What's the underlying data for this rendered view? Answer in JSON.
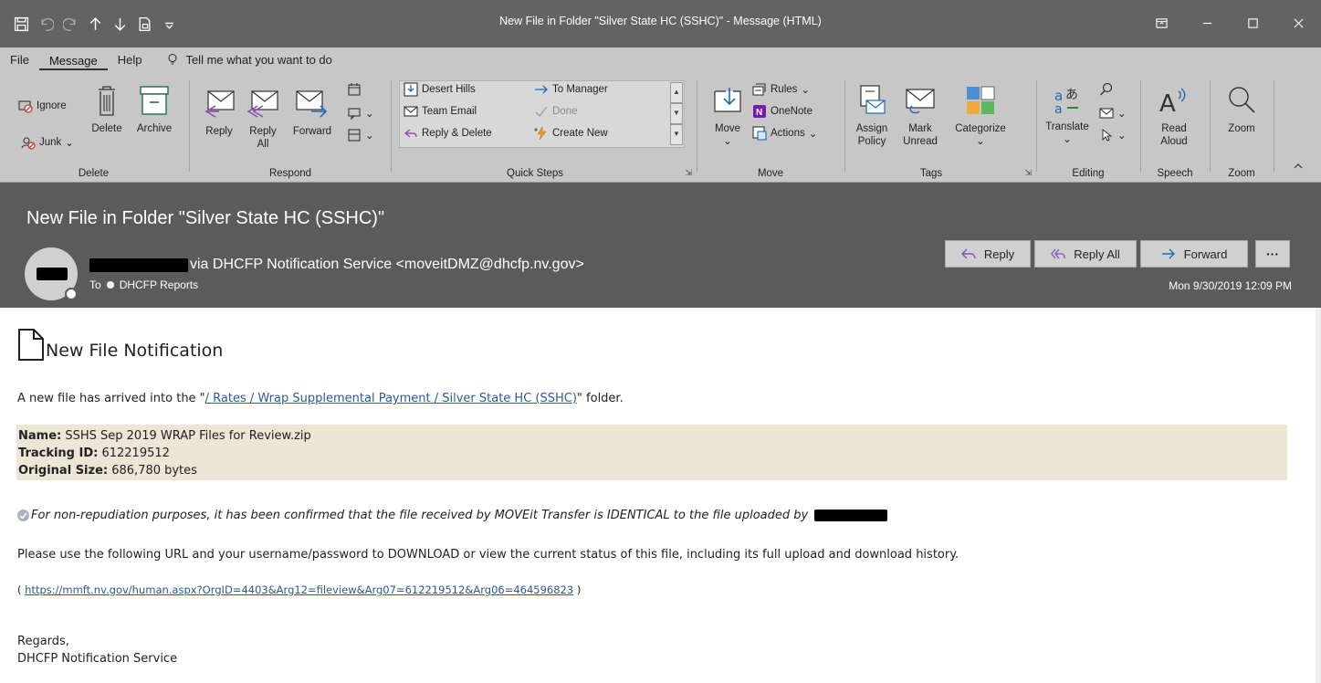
{
  "window": {
    "title": "New File in Folder \"Silver State HC (SSHC)\"  -  Message (HTML)"
  },
  "ribbon_tabs": {
    "file": "File",
    "message": "Message",
    "help": "Help",
    "tell_me": "Tell me what you want to do"
  },
  "ribbon": {
    "delete_group": {
      "label": "Delete",
      "ignore": "Ignore",
      "junk": "Junk",
      "delete": "Delete",
      "archive": "Archive"
    },
    "respond_group": {
      "label": "Respond",
      "reply": "Reply",
      "reply_all_1": "Reply",
      "reply_all_2": "All",
      "forward": "Forward"
    },
    "quick_steps_group": {
      "label": "Quick Steps",
      "desert_hills": "Desert Hills",
      "team_email": "Team Email",
      "reply_delete": "Reply & Delete",
      "to_manager": "To Manager",
      "done": "Done",
      "create_new": "Create New"
    },
    "move_group": {
      "label": "Move",
      "move": "Move",
      "rules": "Rules",
      "onenote": "OneNote",
      "actions": "Actions"
    },
    "tags_group": {
      "label": "Tags",
      "assign_1": "Assign",
      "assign_2": "Policy",
      "mark_1": "Mark",
      "mark_2": "Unread",
      "categorize": "Categorize"
    },
    "editing_group": {
      "label": "Editing",
      "translate": "Translate"
    },
    "speech_group": {
      "label": "Speech",
      "read_1": "Read",
      "read_2": "Aloud"
    },
    "zoom_group": {
      "label": "Zoom",
      "zoom": "Zoom"
    }
  },
  "header": {
    "subject": "New File in Folder \"Silver State HC (SSHC)\"",
    "sender": "via DHCFP Notification Service <moveitDMZ@dhcfp.nv.gov>",
    "to_label": "To",
    "to_recipient": "DHCFP Reports",
    "reply": "Reply",
    "reply_all": "Reply All",
    "forward": "Forward",
    "more": "···",
    "datetime": "Mon 9/30/2019 12:09 PM"
  },
  "body": {
    "heading": "New File Notification",
    "arrive_pre": "A new file has arrived into the \"",
    "arrive_link": "/ Rates / Wrap Supplemental Payment / Silver State HC (SSHC)",
    "arrive_post": "\" folder.",
    "name_label": "Name:",
    "name_value": " SSHS Sep 2019 WRAP Files for Review.zip",
    "tracking_label": "Tracking ID:",
    "tracking_value": " 612219512",
    "size_label": "Original Size:",
    "size_value": " 686,780 bytes",
    "nonrep": "For non-repudiation purposes, it has been confirmed that the file received by MOVEit Transfer is IDENTICAL to the file uploaded by",
    "please": "Please use the following URL and your username/password to DOWNLOAD or view the current status of this file, including its full upload and download history.",
    "url_open": "( ",
    "url": "https://mmft.nv.gov/human.aspx?OrgID=4403&Arg12=fileview&Arg07=612219512&Arg06=464596823",
    "url_close": " )",
    "regards_1": "Regards,",
    "regards_2": "DHCFP Notification Service"
  }
}
